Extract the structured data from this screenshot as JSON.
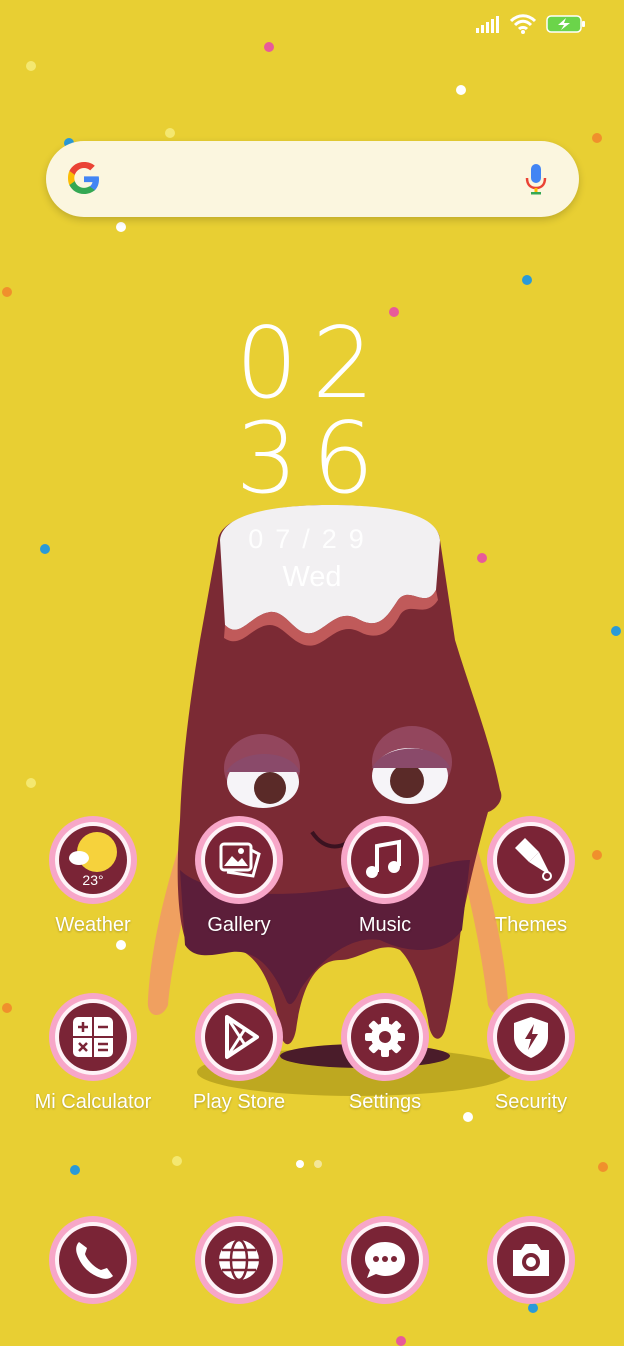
{
  "status_bar": {
    "icons": [
      "signal-icon",
      "wifi-icon",
      "battery-charging-icon"
    ],
    "battery_color": "#6bd44a"
  },
  "search": {
    "logo": "google-g-icon",
    "voice": "microphone-icon"
  },
  "clock": {
    "hour": "02",
    "minute": "36",
    "date": "07/29",
    "weekday": "Wed"
  },
  "apps": [
    {
      "label": "Weather",
      "icon": "weather-icon",
      "badge": "23°"
    },
    {
      "label": "Gallery",
      "icon": "gallery-icon"
    },
    {
      "label": "Music",
      "icon": "music-note-icon"
    },
    {
      "label": "Themes",
      "icon": "paintbrush-icon"
    },
    {
      "label": "Mi Calculator",
      "icon": "calculator-icon"
    },
    {
      "label": "Play Store",
      "icon": "play-store-icon"
    },
    {
      "label": "Settings",
      "icon": "gear-icon"
    },
    {
      "label": "Security",
      "icon": "shield-bolt-icon"
    }
  ],
  "dock": [
    {
      "icon": "phone-icon"
    },
    {
      "icon": "globe-icon"
    },
    {
      "icon": "messages-icon"
    },
    {
      "icon": "camera-icon"
    }
  ],
  "colors": {
    "background": "#e8cf33",
    "icon_fill": "#7a2436",
    "icon_ring": "#f39bc0"
  }
}
